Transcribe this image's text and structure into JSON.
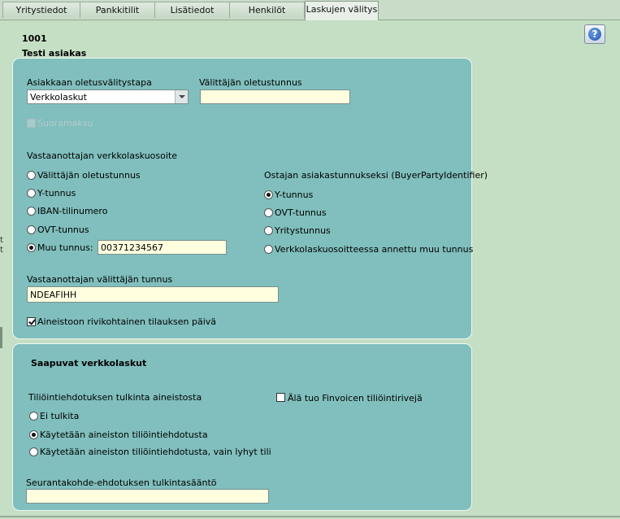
{
  "tabs": [
    {
      "label": "Yritystiedot",
      "active": false
    },
    {
      "label": "Pankkitilit",
      "active": false
    },
    {
      "label": "Lisätiedot",
      "active": false
    },
    {
      "label": "Henkilöt",
      "active": false
    },
    {
      "label": "Laskujen välitys",
      "active": true
    }
  ],
  "customer": {
    "number": "1001",
    "name": "Testi asiakas"
  },
  "left_stub": {
    "line1": "t",
    "line2": "t"
  },
  "section1": {
    "default_method_label": "Asiakkaan oletusvälitystapa",
    "default_method_value": "Verkkolaskut",
    "operator_default_id_label": "Välittäjän oletustunnus",
    "operator_default_id_value": "",
    "direct_payment_label": "Suoramaksu",
    "recipient_address_label": "Vastaanottajan verkkolaskuosoite",
    "recipient_options": [
      "Välittäjän oletustunnus",
      "Y-tunnus",
      "IBAN-tilinumero",
      "OVT-tunnus",
      "Muu tunnus:"
    ],
    "recipient_selected_index": 4,
    "other_id_value": "00371234567",
    "buyer_id_label": "Ostajan asiakastunnukseksi (BuyerPartyIdentifier)",
    "buyer_options": [
      "Y-tunnus",
      "OVT-tunnus",
      "Yritystunnus",
      "Verkkolaskuosoitteessa annettu muu tunnus"
    ],
    "buyer_selected_index": 0,
    "recipient_operator_label": "Vastaanottajan välittäjän tunnus",
    "recipient_operator_value": "NDEAFIHH",
    "row_order_date_label": "Aineistoon rivikohtainen tilauksen päivä",
    "row_order_date_checked": true
  },
  "section2": {
    "title": "Saapuvat verkkolaskut",
    "interpretation_label": "Tiliöintiehdotuksen tulkinta aineistosta",
    "interpretation_options": [
      "Ei tulkita",
      "Käytetään aineiston tiliöintiehdotusta",
      "Käytetään aineiston tiliöintiehdotusta, vain lyhyt tili"
    ],
    "interpretation_selected_index": 1,
    "finvoice_label": "Älä tuo Finvoicen tiliöintirivejä",
    "finvoice_checked": false,
    "tracking_label": "Seurantakohde-ehdotuksen tulkintasääntö",
    "tracking_value": ""
  },
  "help": {
    "glyph": "?",
    "icon": "help-icon"
  }
}
